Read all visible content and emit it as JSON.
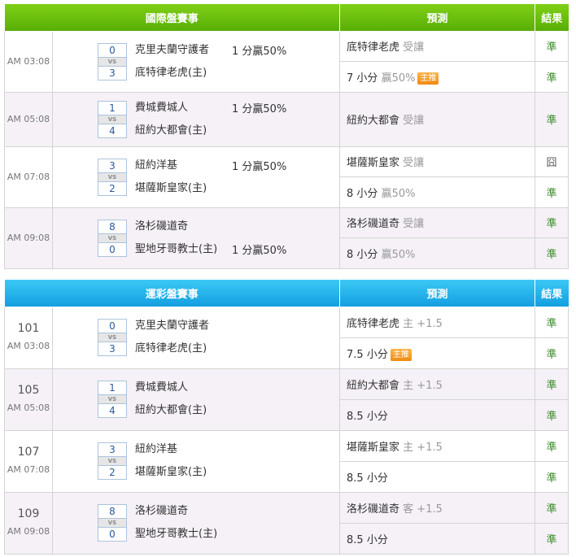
{
  "intl": {
    "header": {
      "col_match": "國際盤賽事",
      "col_pred": "預測",
      "col_result": "結果"
    },
    "games": [
      {
        "time": "AM 03:08",
        "away_score": "0",
        "vs": "VS",
        "home_score": "3",
        "away_team": "克里夫蘭守護者",
        "home_team": "底特律老虎(主)",
        "handicap": "1 分贏50%",
        "handicap_pos": "top",
        "preds": [
          {
            "main": "底特律老虎",
            "extra": "受讓",
            "badge": "",
            "result": "準"
          },
          {
            "main": "7 小分",
            "extra": "贏50%",
            "badge": "主推",
            "result": "準"
          }
        ]
      },
      {
        "time": "AM 05:08",
        "away_score": "1",
        "vs": "VS",
        "home_score": "4",
        "away_team": "費城費城人",
        "home_team": "紐約大都會(主)",
        "handicap": "1 分贏50%",
        "handicap_pos": "top",
        "preds": [
          {
            "main": "紐約大都會",
            "extra": "受讓",
            "badge": "",
            "result": "準"
          }
        ]
      },
      {
        "time": "AM 07:08",
        "away_score": "3",
        "vs": "VS",
        "home_score": "2",
        "away_team": "紐約洋基",
        "home_team": "堪薩斯皇家(主)",
        "handicap": "1 分贏50%",
        "handicap_pos": "top",
        "preds": [
          {
            "main": "堪薩斯皇家",
            "extra": "受讓",
            "badge": "",
            "result": "囧"
          },
          {
            "main": "8 小分",
            "extra": "贏50%",
            "badge": "",
            "result": "準"
          }
        ]
      },
      {
        "time": "AM 09:08",
        "away_score": "8",
        "vs": "VS",
        "home_score": "0",
        "away_team": "洛杉磯道奇",
        "home_team": "聖地牙哥教士(主)",
        "handicap": "1 分贏50%",
        "handicap_pos": "bot",
        "preds": [
          {
            "main": "洛杉磯道奇",
            "extra": "受讓",
            "badge": "",
            "result": "準"
          },
          {
            "main": "8 小分",
            "extra": "贏50%",
            "badge": "",
            "result": "準"
          }
        ]
      }
    ]
  },
  "lottery": {
    "header": {
      "col_match": "運彩盤賽事",
      "col_pred": "預測",
      "col_result": "結果"
    },
    "games": [
      {
        "num": "101",
        "time": "AM 03:08",
        "away_score": "0",
        "vs": "VS",
        "home_score": "3",
        "away_team": "克里夫蘭守護者",
        "home_team": "底特律老虎(主)",
        "preds": [
          {
            "main": "底特律老虎",
            "extra": "主 +1.5",
            "badge": "",
            "result": "準"
          },
          {
            "main": "7.5 小分",
            "extra": "",
            "badge": "主推",
            "result": "準"
          }
        ]
      },
      {
        "num": "105",
        "time": "AM 05:08",
        "away_score": "1",
        "vs": "VS",
        "home_score": "4",
        "away_team": "費城費城人",
        "home_team": "紐約大都會(主)",
        "preds": [
          {
            "main": "紐約大都會",
            "extra": "主 +1.5",
            "badge": "",
            "result": "準"
          },
          {
            "main": "8.5 小分",
            "extra": "",
            "badge": "",
            "result": "準"
          }
        ]
      },
      {
        "num": "107",
        "time": "AM 07:08",
        "away_score": "3",
        "vs": "VS",
        "home_score": "2",
        "away_team": "紐約洋基",
        "home_team": "堪薩斯皇家(主)",
        "preds": [
          {
            "main": "堪薩斯皇家",
            "extra": "主 +1.5",
            "badge": "",
            "result": "準"
          },
          {
            "main": "8.5 小分",
            "extra": "",
            "badge": "",
            "result": "準"
          }
        ]
      },
      {
        "num": "109",
        "time": "AM 09:08",
        "away_score": "8",
        "vs": "VS",
        "home_score": "0",
        "away_team": "洛杉磯道奇",
        "home_team": "聖地牙哥教士(主)",
        "preds": [
          {
            "main": "洛杉磯道奇",
            "extra": "客 +1.5",
            "badge": "",
            "result": "準"
          },
          {
            "main": "8.5 小分",
            "extra": "",
            "badge": "",
            "result": "準"
          }
        ]
      }
    ]
  }
}
